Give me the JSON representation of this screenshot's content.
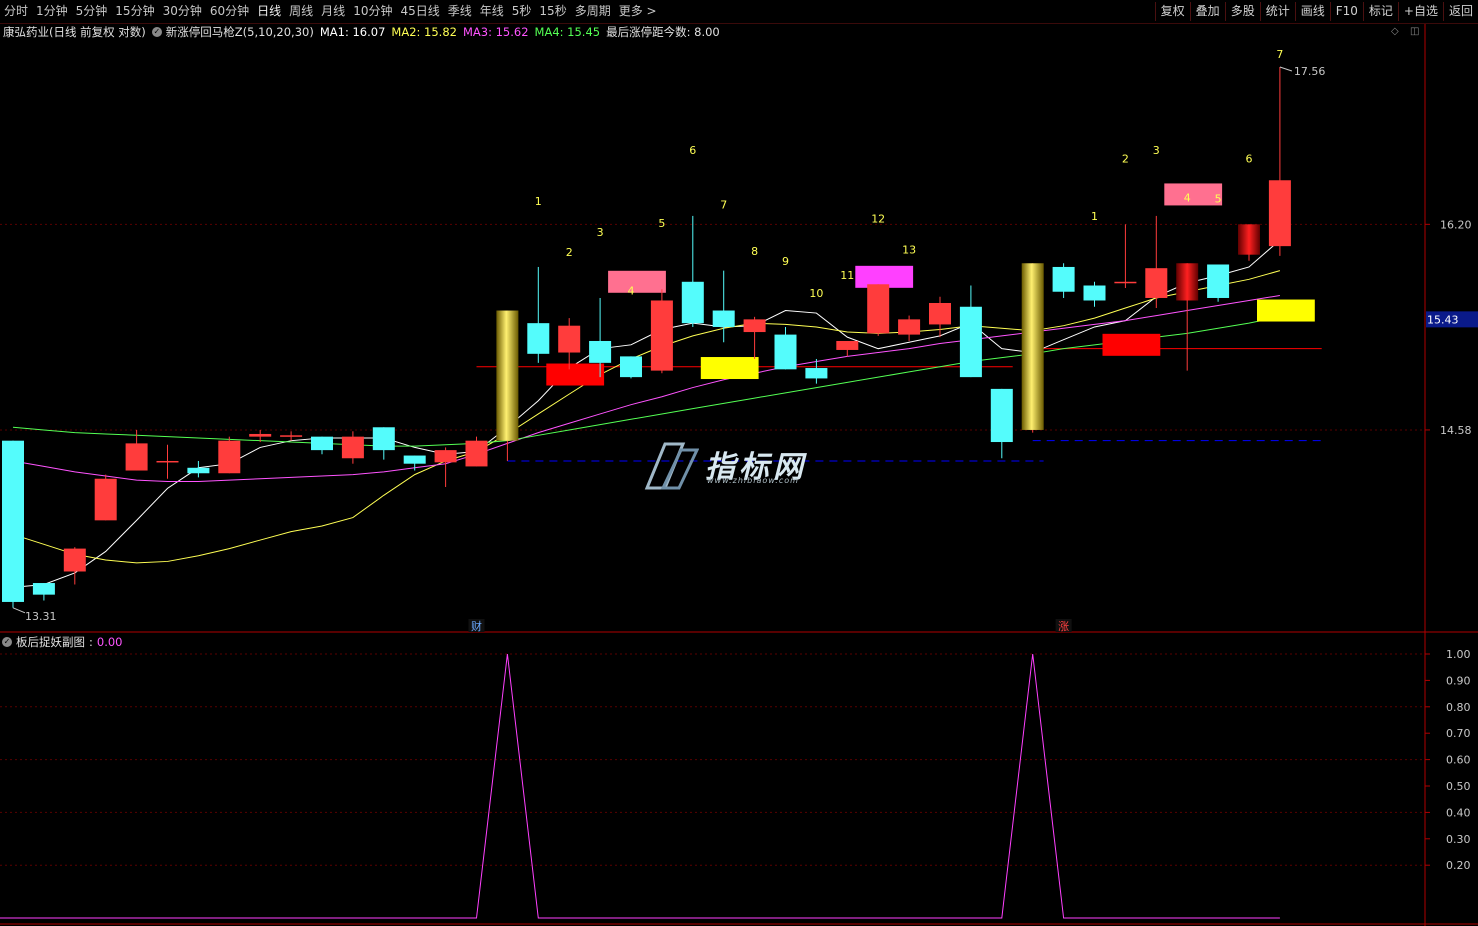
{
  "toolbar": {
    "periods": [
      "分时",
      "1分钟",
      "5分钟",
      "15分钟",
      "30分钟",
      "60分钟",
      "日线",
      "周线",
      "月线",
      "10分钟",
      "45日线",
      "季线",
      "年线",
      "5秒",
      "15秒",
      "多周期",
      "更多 >"
    ],
    "active": "日线",
    "buttons": [
      "复权",
      "叠加",
      "多股",
      "统计",
      "画线",
      "F10",
      "标记",
      "+自选",
      "返回"
    ]
  },
  "info": {
    "stock": "康弘药业(日线 前复权 对数)",
    "indicator": "新涨停回马枪Z(5,10,20,30)",
    "ma1": "MA1: 16.07",
    "ma2": "MA2: 15.82",
    "ma3": "MA3: 15.62",
    "ma4": "MA4: 15.45",
    "last": "最后涨停距今数: 8.00"
  },
  "colors": {
    "up": "#ff3c3c",
    "down": "#54fcfc",
    "ma1": "#ffffff",
    "ma2": "#ffff54",
    "ma3": "#ff54ff",
    "ma4": "#54ff54",
    "grid": "#5a0000",
    "axis": "#b00000",
    "label": "#ffff54"
  },
  "price_axis": {
    "labels": [
      "16.20",
      "14.58"
    ],
    "current": "15.43",
    "high": "17.56",
    "low": "13.31"
  },
  "markers": [
    "财",
    "涨"
  ],
  "sub": {
    "title": "板后捉妖副图",
    "value": "0.00",
    "ticks": [
      "1.00",
      "0.90",
      "0.80",
      "0.70",
      "0.60",
      "0.50",
      "0.40",
      "0.30",
      "0.20"
    ]
  },
  "watermark": {
    "text": "指标网",
    "url": "www.zhibiaow.com"
  },
  "chart_data": {
    "type": "candlestick",
    "candles": [
      [
        14.5,
        13.35,
        14.5,
        13.31
      ],
      [
        13.48,
        13.4,
        13.48,
        13.36
      ],
      [
        13.56,
        13.72,
        13.73,
        13.47
      ],
      [
        13.92,
        14.22,
        14.25,
        13.92
      ],
      [
        14.28,
        14.48,
        14.58,
        14.28
      ],
      [
        14.35,
        14.35,
        14.47,
        14.22
      ],
      [
        14.3,
        14.26,
        14.35,
        14.23
      ],
      [
        14.26,
        14.5,
        14.53,
        14.26
      ],
      [
        14.53,
        14.55,
        14.58,
        14.49
      ],
      [
        14.54,
        14.54,
        14.57,
        14.5
      ],
      [
        14.53,
        14.43,
        14.53,
        14.4
      ],
      [
        14.37,
        14.53,
        14.57,
        14.33
      ],
      [
        14.6,
        14.43,
        14.6,
        14.36
      ],
      [
        14.39,
        14.33,
        14.39,
        14.28
      ],
      [
        14.34,
        14.43,
        14.45,
        14.16
      ],
      [
        14.31,
        14.5,
        14.53,
        14.31
      ],
      [
        14.5,
        15.5,
        15.5,
        14.35
      ],
      [
        15.4,
        15.16,
        15.85,
        15.09
      ],
      [
        15.17,
        15.38,
        15.44,
        15.04
      ],
      [
        15.26,
        15.09,
        15.6,
        14.98
      ],
      [
        15.14,
        14.98,
        15.14,
        14.97
      ],
      [
        15.03,
        15.58,
        15.67,
        15.01
      ],
      [
        15.73,
        15.4,
        16.27,
        15.37
      ],
      [
        15.5,
        15.37,
        15.82,
        15.25
      ],
      [
        15.33,
        15.43,
        15.45,
        15.12
      ],
      [
        15.31,
        15.04,
        15.37,
        15.04
      ],
      [
        15.05,
        14.97,
        15.12,
        14.93
      ],
      [
        15.19,
        15.26,
        15.26,
        15.14
      ],
      [
        15.32,
        15.71,
        15.71,
        15.3
      ],
      [
        15.31,
        15.43,
        15.46,
        15.26
      ],
      [
        15.39,
        15.56,
        15.61,
        15.29
      ],
      [
        15.53,
        14.98,
        15.7,
        14.98
      ],
      [
        14.89,
        14.49,
        14.89,
        14.37
      ],
      [
        14.58,
        15.88,
        15.88,
        14.56
      ],
      [
        15.85,
        15.65,
        15.88,
        15.6
      ],
      [
        15.7,
        15.58,
        15.73,
        15.53
      ],
      [
        15.73,
        15.73,
        16.2,
        15.68
      ],
      [
        15.6,
        15.84,
        16.27,
        15.52
      ],
      [
        15.58,
        15.88,
        15.88,
        15.03
      ],
      [
        15.87,
        15.6,
        15.87,
        15.57
      ],
      [
        15.95,
        16.2,
        16.2,
        15.9
      ],
      [
        16.02,
        16.57,
        17.56,
        15.94
      ]
    ],
    "ma_lines": {
      "ma1": [
        13.45,
        13.47,
        13.55,
        13.7,
        13.92,
        14.15,
        14.3,
        14.33,
        14.45,
        14.5,
        14.52,
        14.52,
        14.52,
        14.45,
        14.4,
        14.42,
        14.6,
        14.8,
        15.05,
        15.2,
        15.23,
        15.35,
        15.4,
        15.37,
        15.38,
        15.5,
        15.48,
        15.29,
        15.2,
        15.25,
        15.3,
        15.4,
        15.2,
        15.17,
        15.27,
        15.37,
        15.42,
        15.61,
        15.72,
        15.78,
        15.85,
        16.07
      ],
      "ma2": [
        13.82,
        13.75,
        13.68,
        13.64,
        13.62,
        13.63,
        13.67,
        13.72,
        13.78,
        13.84,
        13.88,
        13.94,
        14.1,
        14.25,
        14.35,
        14.42,
        14.55,
        14.7,
        14.85,
        15.0,
        15.12,
        15.22,
        15.3,
        15.36,
        15.4,
        15.39,
        15.37,
        15.33,
        15.32,
        15.33,
        15.35,
        15.38,
        15.36,
        15.34,
        15.38,
        15.44,
        15.52,
        15.6,
        15.65,
        15.7,
        15.75,
        15.82
      ],
      "ma3": [
        14.35,
        14.31,
        14.27,
        14.24,
        14.21,
        14.2,
        14.2,
        14.21,
        14.22,
        14.23,
        14.24,
        14.25,
        14.27,
        14.3,
        14.33,
        14.4,
        14.48,
        14.56,
        14.63,
        14.7,
        14.77,
        14.83,
        14.9,
        14.96,
        15.01,
        15.06,
        15.1,
        15.14,
        15.17,
        15.2,
        15.24,
        15.27,
        15.3,
        15.33,
        15.36,
        15.39,
        15.42,
        15.46,
        15.5,
        15.54,
        15.58,
        15.62
      ],
      "ma4": [
        14.6,
        14.58,
        14.56,
        14.55,
        14.54,
        14.53,
        14.52,
        14.51,
        14.5,
        14.49,
        14.48,
        14.47,
        14.46,
        14.46,
        14.47,
        14.48,
        14.5,
        14.54,
        14.58,
        14.62,
        14.66,
        14.7,
        14.74,
        14.78,
        14.82,
        14.86,
        14.9,
        14.94,
        14.98,
        15.02,
        15.06,
        15.1,
        15.13,
        15.16,
        15.2,
        15.23,
        15.26,
        15.29,
        15.32,
        15.36,
        15.4,
        15.45
      ]
    },
    "limit_up_bars": [
      16,
      33
    ],
    "day_counts": [
      {
        "i": 17,
        "t": "1"
      },
      {
        "i": 18,
        "t": "2"
      },
      {
        "i": 19,
        "t": "3"
      },
      {
        "i": 20,
        "t": "4"
      },
      {
        "i": 21,
        "t": "5"
      },
      {
        "i": 22,
        "t": "6"
      },
      {
        "i": 23,
        "t": "7"
      },
      {
        "i": 24,
        "t": "8"
      },
      {
        "i": 25,
        "t": "9"
      },
      {
        "i": 26,
        "t": "10"
      },
      {
        "i": 27,
        "t": "11"
      },
      {
        "i": 28,
        "t": "12"
      },
      {
        "i": 29,
        "t": "13"
      },
      {
        "i": 35,
        "t": "1"
      },
      {
        "i": 36,
        "t": "2"
      },
      {
        "i": 37,
        "t": "3"
      },
      {
        "i": 38,
        "t": "4"
      },
      {
        "i": 39,
        "t": "5"
      },
      {
        "i": 40,
        "t": "6"
      },
      {
        "i": 41,
        "t": "7"
      }
    ],
    "blocks": [
      {
        "i0": 17,
        "i1": 19,
        "p": 15.0,
        "color": "#ff0000"
      },
      {
        "i0": 19,
        "i1": 21,
        "p": 15.73,
        "color": "#ff7090"
      },
      {
        "i0": 22,
        "i1": 24,
        "p": 15.05,
        "color": "#ffff00"
      },
      {
        "i0": 27,
        "i1": 29,
        "p": 15.77,
        "color": "#ff40ff"
      },
      {
        "i0": 35,
        "i1": 37,
        "p": 15.23,
        "color": "#ff0000"
      },
      {
        "i0": 37,
        "i1": 39,
        "p": 16.45,
        "color": "#ff7090"
      },
      {
        "i0": 40,
        "i1": 42,
        "p": 15.5,
        "color": "#ffff00"
      }
    ],
    "support_lines": [
      {
        "i0": 16,
        "i1": 34,
        "p": 14.35,
        "color": "#0000ff"
      },
      {
        "i0": 33,
        "i1": 43,
        "p": 14.5,
        "color": "#0000ff"
      },
      {
        "i0": 15,
        "i1": 33,
        "p": 15.06,
        "color": "#ff0000"
      },
      {
        "i0": 33,
        "i1": 43,
        "p": 15.2,
        "color": "#ff0000"
      }
    ],
    "sub_series": [
      0,
      0,
      0,
      0,
      0,
      0,
      0,
      0,
      0,
      0,
      0,
      0,
      0,
      0,
      0,
      0,
      1,
      0,
      0,
      0,
      0,
      0,
      0,
      0,
      0,
      0,
      0,
      0,
      0,
      0,
      0,
      0,
      0,
      1,
      0,
      0,
      0,
      0,
      0,
      0,
      0,
      0
    ]
  }
}
